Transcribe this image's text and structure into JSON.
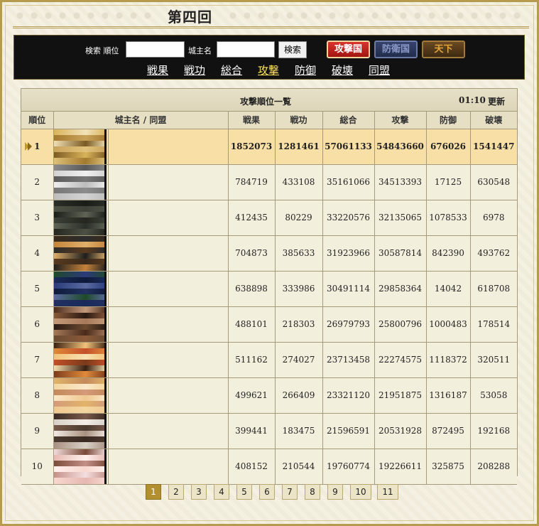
{
  "page": {
    "title": "第四回"
  },
  "search": {
    "rank_label": "検索 順位",
    "rank_value": "",
    "owner_label": "城主名",
    "owner_value": "",
    "search_button": "検索",
    "tag_attack": "攻撃国",
    "tag_defend": "防衛国",
    "tag_tenka": "天下"
  },
  "nav": {
    "items": [
      "戦果",
      "戦功",
      "総合",
      "攻撃",
      "防御",
      "破壊",
      "同盟"
    ],
    "active": "攻撃"
  },
  "ranking": {
    "title": "攻撃順位一覧",
    "time": "01:10",
    "update": "更新",
    "headers": [
      "順位",
      "城主名 / 同盟",
      "戦果",
      "戦功",
      "総合",
      "攻撃",
      "防御",
      "破壊"
    ],
    "rows": [
      {
        "rank": "1",
        "name": "",
        "senka": "1852073",
        "senkou": "1281461",
        "sougou": "57061133",
        "kougeki": "54843660",
        "bougyo": "676026",
        "hakai": "1541447",
        "highlight": true,
        "avatar_colors": [
          "#d9b35a",
          "#a37a2e",
          "#f2e2b8",
          "#c9a25a",
          "#7a5a22",
          "#e0c27a"
        ]
      },
      {
        "rank": "2",
        "name": "",
        "senka": "784719",
        "senkou": "433108",
        "sougou": "35161066",
        "kougeki": "34513393",
        "bougyo": "17125",
        "hakai": "630548",
        "highlight": false,
        "avatar_colors": [
          "#8c8c8c",
          "#d2d2d2",
          "#5a5a5a",
          "#efefef",
          "#777777",
          "#bdbdbd"
        ]
      },
      {
        "rank": "3",
        "name": "",
        "senka": "412435",
        "senkou": "80229",
        "sougou": "33220576",
        "kougeki": "32135065",
        "bougyo": "1078533",
        "hakai": "6978",
        "highlight": false,
        "avatar_colors": [
          "#2b2f2a",
          "#4d5145",
          "#1a1c18",
          "#3e4137",
          "#5f6455",
          "#24261f"
        ]
      },
      {
        "rank": "4",
        "name": "",
        "senka": "704873",
        "senkou": "385633",
        "sougou": "31923966",
        "kougeki": "30587814",
        "bougyo": "842390",
        "hakai": "493762",
        "highlight": false,
        "avatar_colors": [
          "#3a2a1c",
          "#c4823a",
          "#2c2c2c",
          "#e0b06a",
          "#5a3a1e",
          "#1e1e1e"
        ]
      },
      {
        "rank": "5",
        "name": "",
        "senka": "638898",
        "senkou": "333986",
        "sougou": "30491114",
        "kougeki": "29858364",
        "bougyo": "14042",
        "hakai": "618708",
        "highlight": false,
        "avatar_colors": [
          "#1f4a2a",
          "#1b2a5a",
          "#2a3a7a",
          "#0e1a3a",
          "#5a6aa0",
          "#223060"
        ]
      },
      {
        "rank": "6",
        "name": "",
        "senka": "488101",
        "senkou": "218303",
        "sougou": "26979793",
        "kougeki": "25800796",
        "bougyo": "1000483",
        "hakai": "178514",
        "highlight": false,
        "avatar_colors": [
          "#4a2a1a",
          "#8a5a3a",
          "#c49a7a",
          "#2a1a12",
          "#a57a5a",
          "#6a4a30"
        ]
      },
      {
        "rank": "7",
        "name": "",
        "senka": "511162",
        "senkou": "274027",
        "sougou": "23713458",
        "kougeki": "22274575",
        "bougyo": "1118372",
        "hakai": "320511",
        "highlight": false,
        "avatar_colors": [
          "#3a2010",
          "#e08a3a",
          "#f2c27a",
          "#c4502a",
          "#f8e0b0",
          "#7a3a1a"
        ]
      },
      {
        "rank": "8",
        "name": "",
        "senka": "499621",
        "senkou": "266409",
        "sougou": "23321120",
        "kougeki": "21951875",
        "bougyo": "1316187",
        "hakai": "53058",
        "highlight": false,
        "avatar_colors": [
          "#e2b46a",
          "#f4d6a0",
          "#c48a5a",
          "#fae8c8",
          "#d49a7a",
          "#f0c890"
        ]
      },
      {
        "rank": "9",
        "name": "",
        "senka": "399441",
        "senkou": "183475",
        "sougou": "21596591",
        "kougeki": "20531928",
        "bougyo": "872495",
        "hakai": "192168",
        "highlight": false,
        "avatar_colors": [
          "#3a2a22",
          "#d8d0c8",
          "#7a5a4a",
          "#f2ece6",
          "#4a3a30",
          "#a89080"
        ]
      },
      {
        "rank": "10",
        "name": "",
        "senka": "408152",
        "senkou": "210544",
        "sougou": "19760774",
        "kougeki": "19226611",
        "bougyo": "325875",
        "hakai": "208288",
        "highlight": false,
        "avatar_colors": [
          "#f4dede",
          "#e6b8b0",
          "#7a4a3a",
          "#fff0ec",
          "#c49088",
          "#f8d8d0"
        ]
      }
    ]
  },
  "pagination": {
    "pages": [
      "1",
      "2",
      "3",
      "4",
      "5",
      "6",
      "7",
      "8",
      "9",
      "10",
      "11"
    ],
    "current": "1"
  },
  "colors": {
    "highlight_row": "#f8dfa5",
    "accent_gold": "#b3902f",
    "bar_bg": "#111111"
  }
}
